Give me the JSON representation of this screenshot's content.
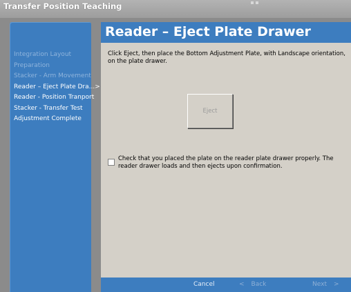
{
  "window": {
    "title": "Transfer Position Teaching"
  },
  "sidebar": {
    "steps": [
      {
        "label": "Integration Layout"
      },
      {
        "label": "Preparation"
      },
      {
        "label": "Stacker - Arm Movement"
      },
      {
        "label": "Reader – Eject Plate Dra..."
      },
      {
        "label": "Reader - Position Tranport"
      },
      {
        "label": "Stacker - Transfer Test"
      },
      {
        "label": "Adjustment Complete"
      }
    ]
  },
  "page": {
    "heading": "Reader – Eject Plate Drawer",
    "instruction": "Click Eject, then place the Bottom Adjustment Plate, with Landscape orientation, on the plate drawer.",
    "eject_label": "Eject",
    "confirm_text": "Check that you placed the plate on the reader plate drawer properly. The reader drawer loads and then ejects upon confirmation.",
    "confirm_checked": false
  },
  "footer": {
    "cancel_label": "Cancel",
    "back_label": "Back",
    "next_label": "Next",
    "back_glyph": "<",
    "next_glyph": ">",
    "active_step_glyph": ">"
  },
  "colors": {
    "panel_blue": "#3d7dbf",
    "window_gray": "#d4d0c8",
    "completed_step": "#8fb4dc"
  }
}
